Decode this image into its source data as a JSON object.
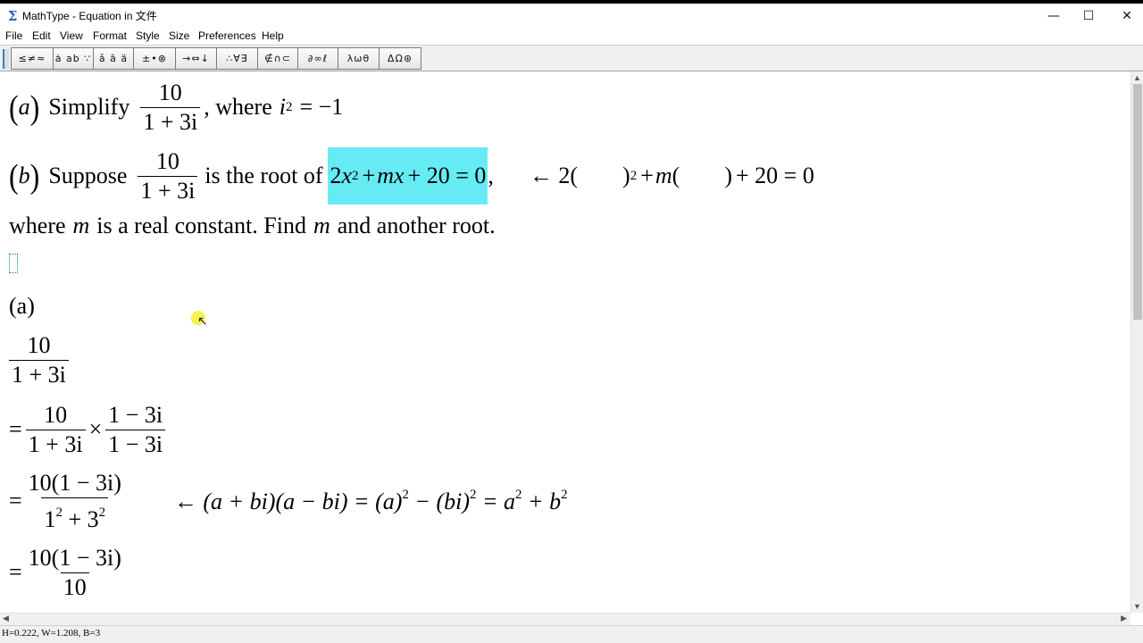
{
  "window": {
    "title": "MathType - Equation in 文件",
    "app_icon": "Σ",
    "minimize": "—",
    "maximize": "☐",
    "close": "✕"
  },
  "menu": [
    "File",
    "Edit",
    "View",
    "Format",
    "Style",
    "Size",
    "Preferences",
    "Help"
  ],
  "toolbar": {
    "palettes": [
      {
        "label": "≤≠≈",
        "icon": "relations-palette-icon"
      },
      {
        "label": "ȧ ab ∵",
        "icon": "spaces-ellipses-palette-icon"
      },
      {
        "label": "ǎ ā ä",
        "icon": "embellishments-palette-icon"
      },
      {
        "label": "±•⊗",
        "icon": "operators-palette-icon"
      },
      {
        "label": "→⇔↓",
        "icon": "arrows-palette-icon"
      },
      {
        "label": "∴∀∃",
        "icon": "logic-palette-icon"
      },
      {
        "label": "∉∩⊂",
        "icon": "set-theory-palette-icon"
      },
      {
        "label": "∂∞ℓ",
        "icon": "misc-symbols-palette-icon"
      },
      {
        "label": "λωθ",
        "icon": "greek-lowercase-palette-icon"
      },
      {
        "label": "ΔΩ⊛",
        "icon": "greek-uppercase-palette-icon"
      }
    ]
  },
  "document": {
    "q_a": {
      "label_open": "(",
      "label_var": "a",
      "label_close": ")",
      "word": "Simplify",
      "frac_num": "10",
      "frac_den": "1 + 3i",
      "tail": ", where",
      "var_i": "i",
      "exp": "2",
      "rhs": "= −1"
    },
    "q_b": {
      "label_open": "(",
      "label_var": "b",
      "label_close": ")",
      "word": "Suppose",
      "frac_num": "10",
      "frac_den": "1 + 3i",
      "mid": "is the root of",
      "highlight_coef": "2",
      "highlight_x": "x",
      "highlight_exp": "2",
      "highlight_rest_plus": "+",
      "highlight_m": "m",
      "highlight_x2": "x",
      "highlight_tail": "+ 20 = 0",
      "comma": ",",
      "arrow_expr_start": "← 2(",
      "arrow_expr_close1": ")",
      "arrow_exp": "2",
      "arrow_plus": "+",
      "arrow_m": "m",
      "arrow_open2": "(",
      "arrow_close2": ")",
      "arrow_tail": "+ 20 = 0"
    },
    "q_b_line2": {
      "part1": "where",
      "m1": "m",
      "part2": "is a real constant.  Find",
      "m2": "m",
      "part3": "and another root."
    },
    "sol_a_label": "(a)",
    "step1": {
      "num": "10",
      "den": "1 + 3i"
    },
    "step2": {
      "eq": "=",
      "num1": "10",
      "den1": "1 + 3i",
      "times": "×",
      "num2": "1 − 3i",
      "den2": "1 − 3i"
    },
    "step3": {
      "eq": "=",
      "num": "10(1 − 3i)",
      "den_a": "1",
      "den_exp1": "2",
      "den_plus": "+ 3",
      "den_exp2": "2",
      "note_lhs": "← (a + bi)(a − bi) = (a)",
      "note_e1": "2",
      "note_mid": " − (bi)",
      "note_e2": "2",
      "note_mid2": " = a",
      "note_e3": "2",
      "note_mid3": " + b",
      "note_e4": "2"
    },
    "step4": {
      "eq": "=",
      "num": "10(1 − 3i)",
      "den": "10"
    }
  },
  "status": "H=0.222, W=1.208, B=3"
}
